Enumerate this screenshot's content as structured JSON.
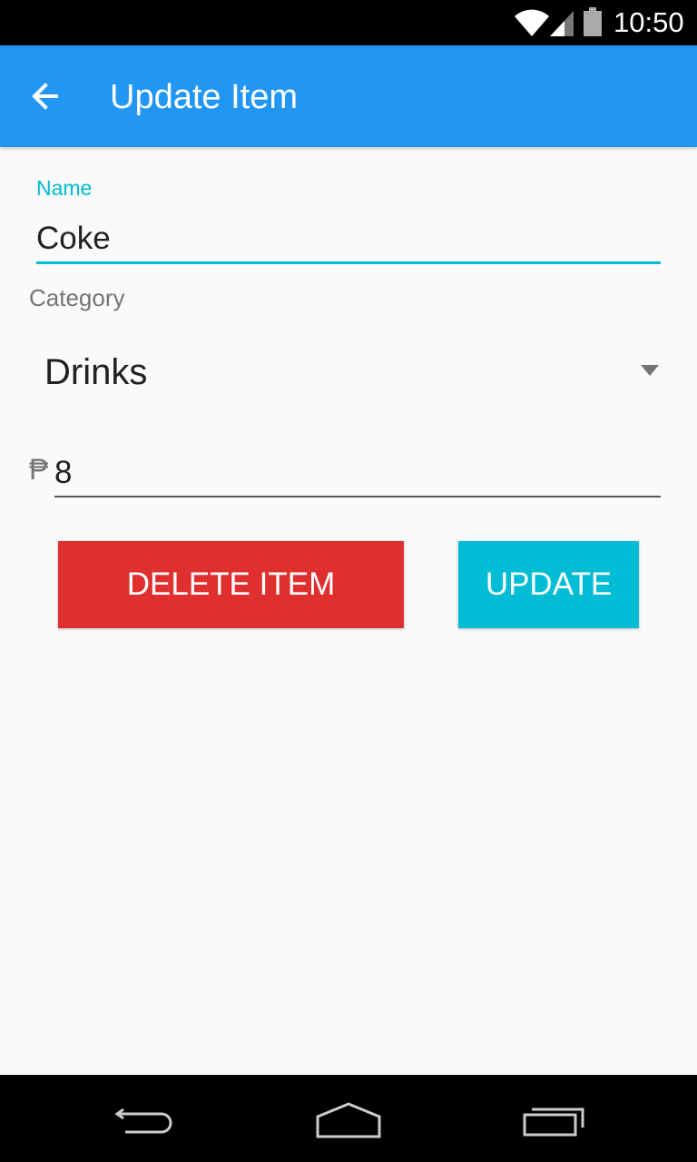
{
  "status_bar": {
    "time": "10:50"
  },
  "app_bar": {
    "title": "Update Item"
  },
  "form": {
    "name_label": "Name",
    "name_value": "Coke",
    "category_label": "Category",
    "category_value": "Drinks",
    "currency_symbol": "₱",
    "price_value": "8"
  },
  "buttons": {
    "delete_label": "DELETE ITEM",
    "update_label": "UPDATE"
  },
  "colors": {
    "app_bar": "#2196f3",
    "accent": "#00bcd4",
    "delete": "#e02f2f",
    "background": "#fafafa"
  },
  "icons": {
    "back": "arrow-left-icon",
    "wifi": "wifi-icon",
    "signal": "signal-icon",
    "battery": "battery-icon",
    "caret": "dropdown-caret-icon",
    "nav_back": "nav-back-icon",
    "nav_home": "nav-home-icon",
    "nav_recents": "nav-recents-icon"
  }
}
